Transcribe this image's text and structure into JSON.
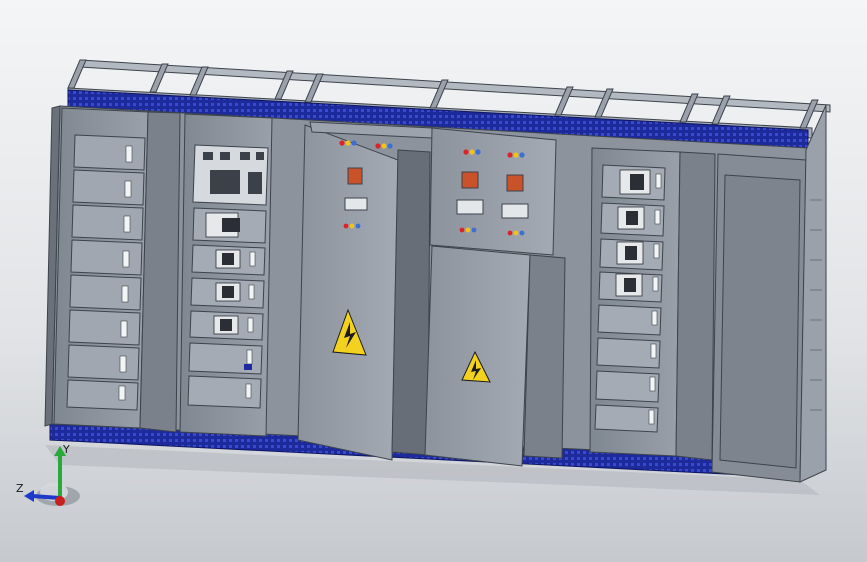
{
  "viewport": {
    "background_top": "#f4f5f6",
    "background_bottom": "#c9ccd0"
  },
  "model": {
    "cabinet_count": 6,
    "frame_color": "#9aa1ab",
    "panel_color": "#8f96a0",
    "panel_dark": "#737a84",
    "base_band_color": "#1c2a9c",
    "warning_color": "#f2d21e"
  },
  "triad": {
    "x_axis_color": "#c8201e",
    "y_axis_color": "#2aa83a",
    "z_axis_color": "#1e3ac8",
    "y_label": "Y",
    "z_label": "Z"
  }
}
